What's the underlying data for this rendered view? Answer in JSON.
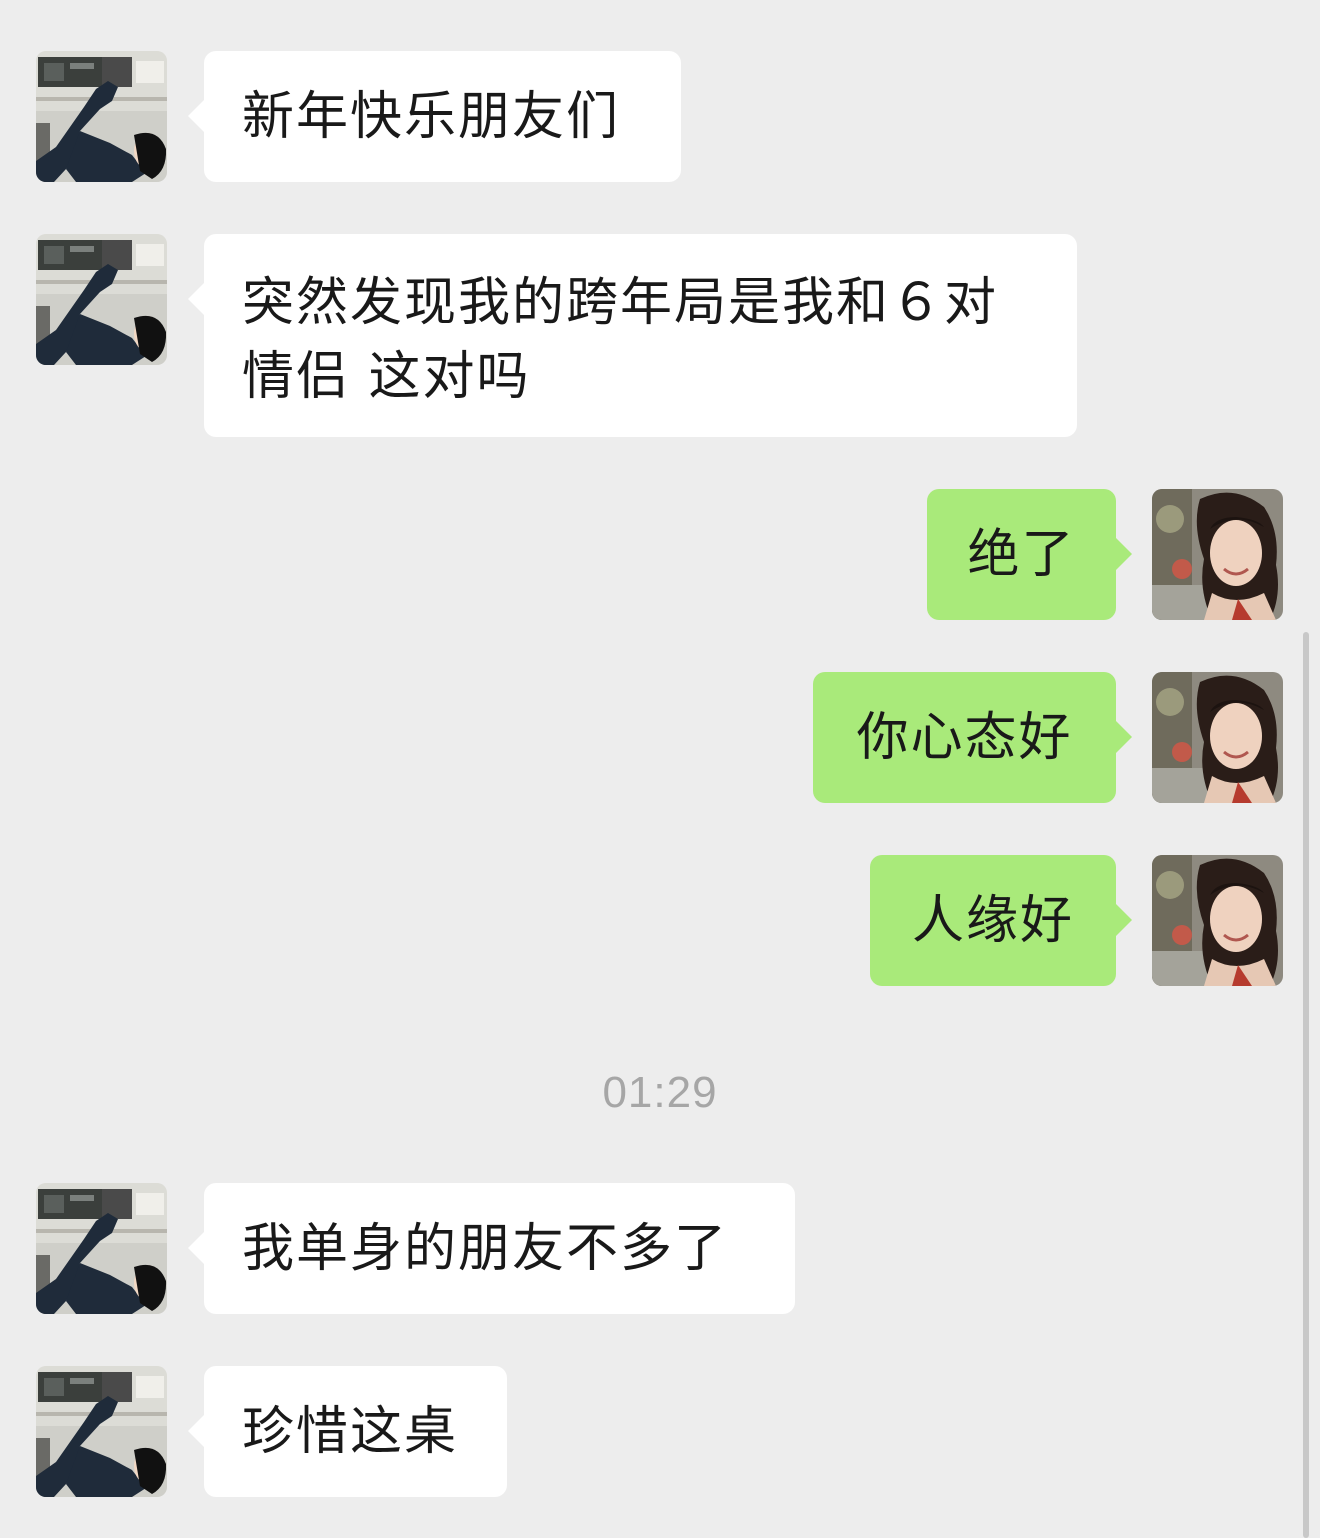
{
  "messages": [
    {
      "side": "in",
      "text": "新年快乐朋友们"
    },
    {
      "side": "in",
      "text": "突然发现我的跨年局是我和６对情侣 这对吗"
    },
    {
      "side": "out",
      "text": "绝了"
    },
    {
      "side": "out",
      "text": "你心态好"
    },
    {
      "side": "out",
      "text": "人缘好"
    },
    {
      "side": "in",
      "text": "我单身的朋友不多了"
    },
    {
      "side": "in",
      "text": "珍惜这桌"
    }
  ],
  "timestamp": "01:29",
  "colors": {
    "background": "#ededed",
    "incoming_bubble": "#ffffff",
    "outgoing_bubble": "#a9ea7a",
    "text": "#191919",
    "timestamp": "#a6a6a6"
  }
}
